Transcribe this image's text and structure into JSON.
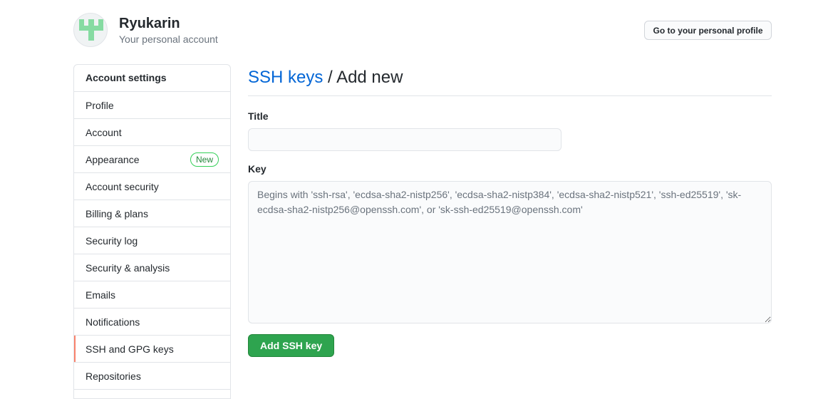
{
  "account": {
    "name": "Ryukarin",
    "subtitle": "Your personal account",
    "profile_button": "Go to your personal profile"
  },
  "sidebar": {
    "heading": "Account settings",
    "items": [
      {
        "label": "Profile"
      },
      {
        "label": "Account"
      },
      {
        "label": "Appearance",
        "badge": "New"
      },
      {
        "label": "Account security"
      },
      {
        "label": "Billing & plans"
      },
      {
        "label": "Security log"
      },
      {
        "label": "Security & analysis"
      },
      {
        "label": "Emails"
      },
      {
        "label": "Notifications"
      },
      {
        "label": "SSH and GPG keys",
        "selected": true
      },
      {
        "label": "Repositories"
      }
    ]
  },
  "main": {
    "breadcrumb_link": "SSH keys",
    "breadcrumb_separator": "/",
    "breadcrumb_current": "Add new",
    "title_label": "Title",
    "title_value": "",
    "key_label": "Key",
    "key_value": "",
    "key_placeholder": "Begins with 'ssh-rsa', 'ecdsa-sha2-nistp256', 'ecdsa-sha2-nistp384', 'ecdsa-sha2-nistp521', 'ssh-ed25519', 'sk-ecdsa-sha2-nistp256@openssh.com', or 'sk-ssh-ed25519@openssh.com'",
    "submit_button": "Add SSH key"
  },
  "colors": {
    "link": "#0366d6",
    "primary_button": "#2ea44f",
    "selected_indicator": "#f9826c",
    "badge": "#22863a"
  }
}
